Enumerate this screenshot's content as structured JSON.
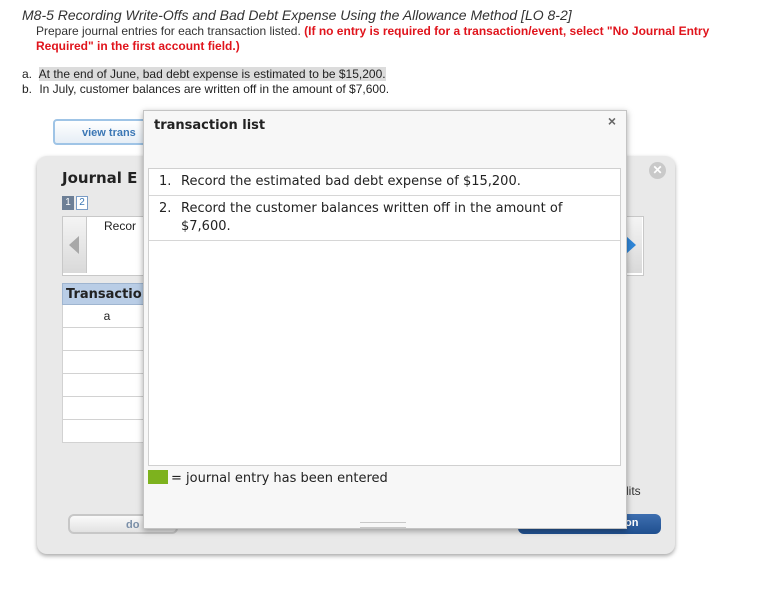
{
  "problem": {
    "title": "M8-5 Recording Write-Offs and Bad Debt Expense Using the Allowance Method [LO 8-2]",
    "instruction": "Prepare journal entries for each transaction listed.",
    "instruction_note": "(If no entry is required for a transaction/event, select \"No Journal Entry Required\" in the first account field.)",
    "items": [
      {
        "label": "a.",
        "text": "At the end of June, bad debt expense is estimated to be $15,200."
      },
      {
        "label": "b.",
        "text": "In July, customer balances are written off in the amount of $7,600."
      }
    ]
  },
  "background": {
    "view_button": "view trans",
    "journal_title": "Journal E",
    "pages": [
      "1",
      "2"
    ],
    "record_text": "Recor",
    "table_header": "Transactio",
    "rows": [
      "a",
      "",
      "",
      "",
      "",
      ""
    ],
    "credits_text": "lits",
    "left_button": "do",
    "right_button": "on",
    "close_symbol": "✕"
  },
  "modal": {
    "title": "transaction list",
    "close_symbol": "×",
    "transactions": [
      {
        "num": "1.",
        "text": "Record the estimated bad debt expense of $15,200."
      },
      {
        "num": "2.",
        "text": "Record the customer balances written off in the amount of $7,600."
      }
    ],
    "legend_text": "= journal entry has been entered",
    "legend_color": "#7db21e"
  }
}
